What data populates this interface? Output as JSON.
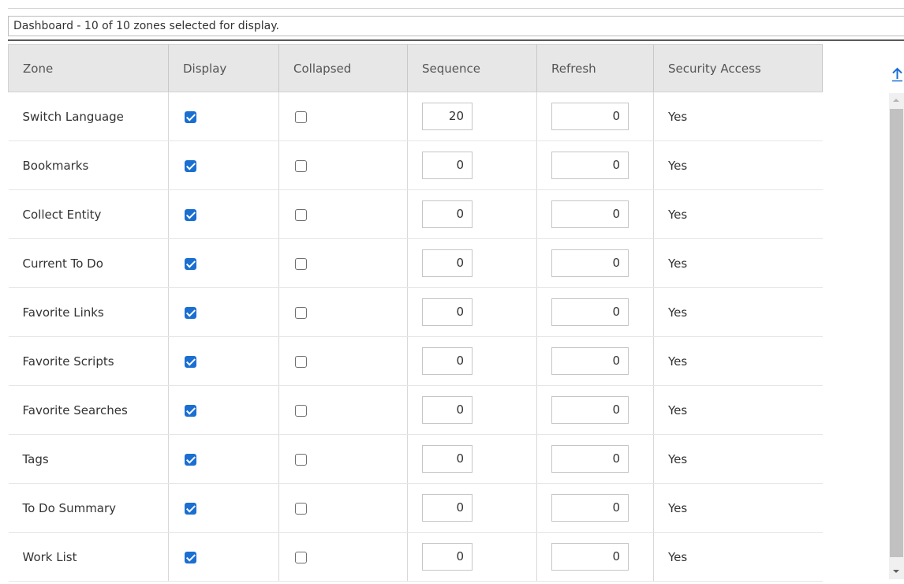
{
  "header": {
    "title": "Dashboard - 10 of 10 zones selected for display."
  },
  "columns": [
    "Zone",
    "Display",
    "Collapsed",
    "Sequence",
    "Refresh",
    "Security Access"
  ],
  "rows": [
    {
      "zone": "Switch Language",
      "display": true,
      "collapsed": false,
      "sequence": "20",
      "refresh": "0",
      "security": "Yes"
    },
    {
      "zone": "Bookmarks",
      "display": true,
      "collapsed": false,
      "sequence": "0",
      "refresh": "0",
      "security": "Yes"
    },
    {
      "zone": "Collect Entity",
      "display": true,
      "collapsed": false,
      "sequence": "0",
      "refresh": "0",
      "security": "Yes"
    },
    {
      "zone": "Current To Do",
      "display": true,
      "collapsed": false,
      "sequence": "0",
      "refresh": "0",
      "security": "Yes"
    },
    {
      "zone": "Favorite Links",
      "display": true,
      "collapsed": false,
      "sequence": "0",
      "refresh": "0",
      "security": "Yes"
    },
    {
      "zone": "Favorite Scripts",
      "display": true,
      "collapsed": false,
      "sequence": "0",
      "refresh": "0",
      "security": "Yes"
    },
    {
      "zone": "Favorite Searches",
      "display": true,
      "collapsed": false,
      "sequence": "0",
      "refresh": "0",
      "security": "Yes"
    },
    {
      "zone": "Tags",
      "display": true,
      "collapsed": false,
      "sequence": "0",
      "refresh": "0",
      "security": "Yes"
    },
    {
      "zone": "To Do Summary",
      "display": true,
      "collapsed": false,
      "sequence": "0",
      "refresh": "0",
      "security": "Yes"
    },
    {
      "zone": "Work List",
      "display": true,
      "collapsed": false,
      "sequence": "0",
      "refresh": "0",
      "security": "Yes"
    }
  ],
  "icons": {
    "scroll_top": "arrow-up-icon",
    "scroll_up": "scroll-up-arrow-icon",
    "scroll_down": "scroll-down-arrow-icon"
  },
  "colors": {
    "accent": "#1a6fd1",
    "header_bg": "#e7e7e7",
    "text": "#333333"
  }
}
